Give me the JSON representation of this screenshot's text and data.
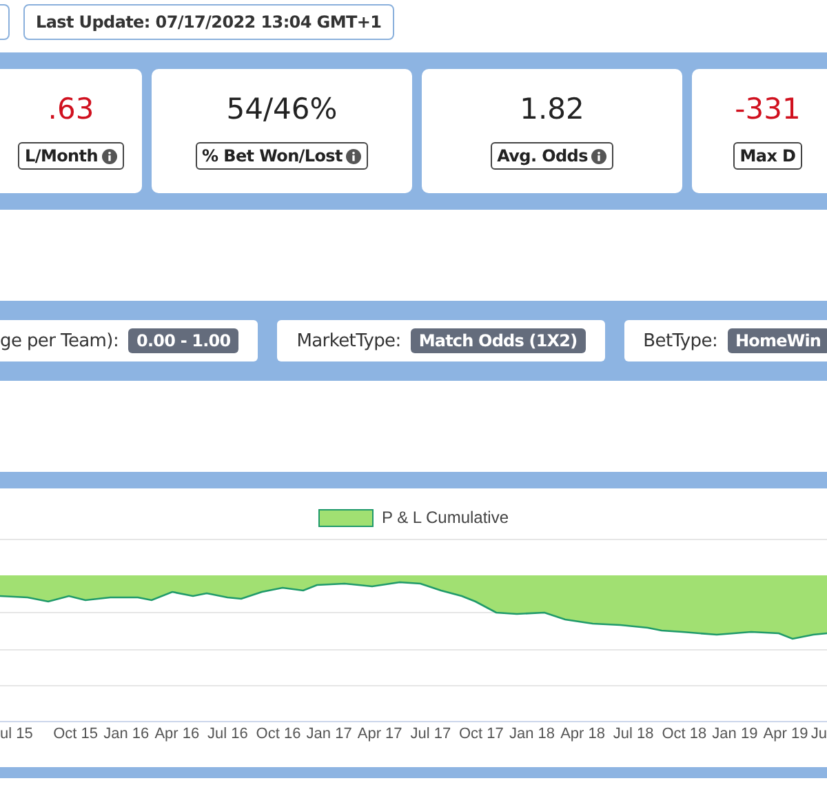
{
  "last_update": "Last Update: 07/17/2022 13:04 GMT+1",
  "stats": [
    {
      "value": ".63",
      "label": "L/Month",
      "negative": true,
      "info": true
    },
    {
      "value": "54/46%",
      "label": "% Bet Won/Lost",
      "negative": false,
      "info": true
    },
    {
      "value": "1.82",
      "label": "Avg. Odds",
      "negative": false,
      "info": true
    },
    {
      "value": "-331",
      "label": "Max D",
      "negative": true,
      "info": false
    }
  ],
  "filters": [
    {
      "label": "ge per Team):",
      "value": "0.00 - 1.00"
    },
    {
      "label": "MarketType:",
      "value": "Match Odds (1X2)"
    },
    {
      "label": "BetType:",
      "value": "HomeWin"
    }
  ],
  "chart": {
    "legend": "P & L Cumulative",
    "x_labels": [
      "ul 15",
      "Oct 15",
      "Jan 16",
      "Apr 16",
      "Jul 16",
      "Oct 16",
      "Jan 17",
      "Apr 17",
      "Jul 17",
      "Oct 17",
      "Jan 18",
      "Apr 18",
      "Jul 18",
      "Oct 18",
      "Jan 19",
      "Apr 19",
      "Ju"
    ]
  }
}
